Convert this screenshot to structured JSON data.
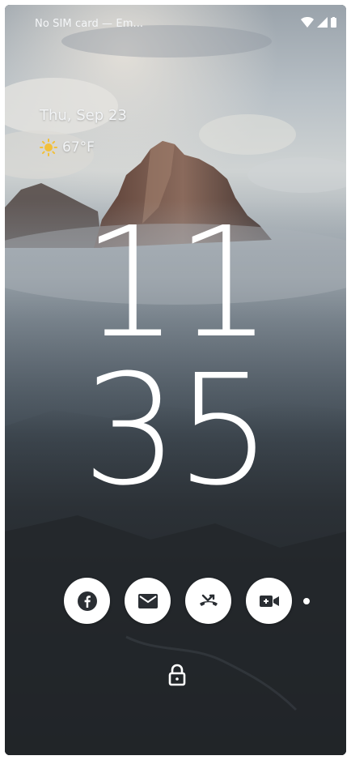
{
  "status_bar": {
    "carrier": "No SIM card — Em...",
    "icons": [
      "wifi-icon",
      "cell-signal-icon",
      "battery-icon"
    ]
  },
  "lockscreen": {
    "date": "Thu, Sep 23",
    "weather": {
      "icon": "sun-icon",
      "temperature": "67°F"
    },
    "clock": {
      "hours": "11",
      "minutes": "35"
    },
    "notification_icons": [
      "facebook-icon",
      "email-icon",
      "missed-call-icon",
      "video-call-icon"
    ],
    "more_indicator": "more-notifications-dot",
    "lock_icon": "lock-icon"
  },
  "colors": {
    "clock_text": "#ffffff",
    "icon_bg": "#ffffff",
    "icon_fg": "#2a2e33"
  }
}
